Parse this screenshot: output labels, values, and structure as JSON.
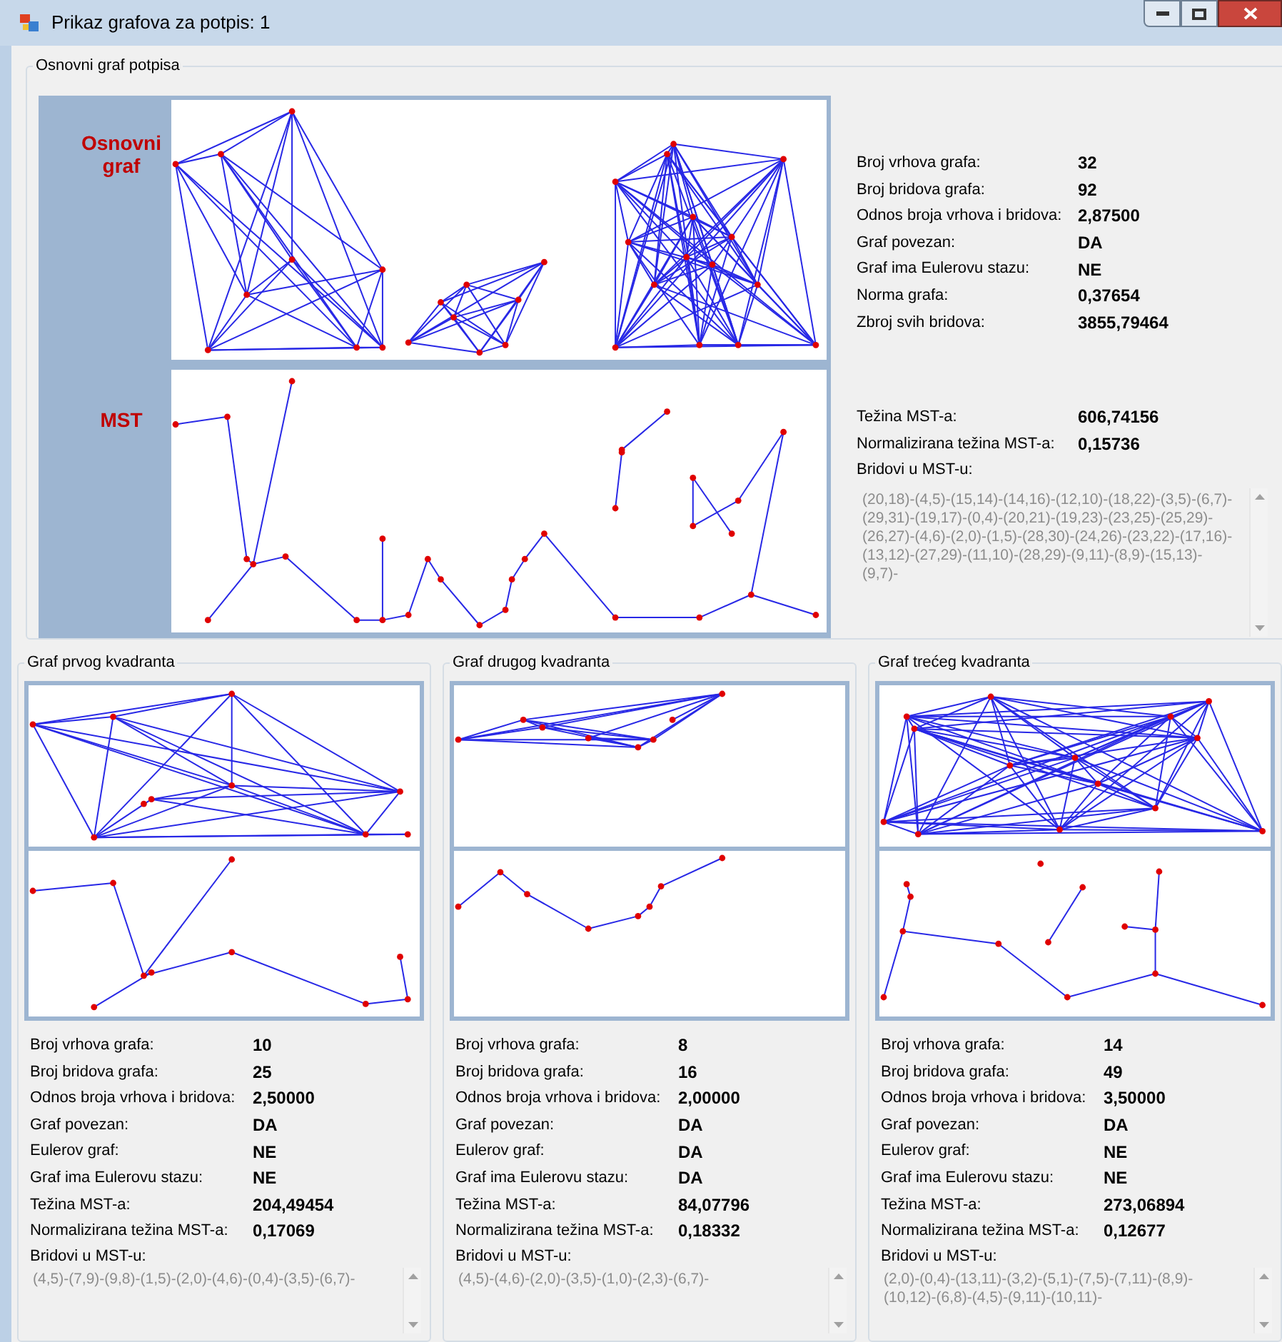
{
  "window": {
    "title": "Prikaz grafova za potpis: 1"
  },
  "main": {
    "title": "Osnovni graf potpisa",
    "graph_label": "Osnovni graf",
    "mst_label": "MST",
    "stats": [
      {
        "label": "Broj vrhova grafa:",
        "value": "32"
      },
      {
        "label": "Broj bridova grafa:",
        "value": "92"
      },
      {
        "label": "Odnos broja vrhova i bridova:",
        "value": "2,87500"
      },
      {
        "label": "Graf povezan:",
        "value": "DA"
      },
      {
        "label": "Graf ima Eulerovu stazu:",
        "value": "NE"
      },
      {
        "label": "Norma grafa:",
        "value": "0,37654"
      },
      {
        "label": "Zbroj svih bridova:",
        "value": "3855,79464"
      }
    ],
    "mst_stats": [
      {
        "label": "Težina MST-a:",
        "value": "606,74156"
      },
      {
        "label": "Normalizirana težina MST-a:",
        "value": "0,15736"
      }
    ],
    "edges_label": "Bridovi u MST-u:",
    "edges": "(20,18)-(4,5)-(15,14)-(14,16)-(12,10)-(18,22)-(3,5)-(6,7)-(29,31)-(19,17)-(0,4)-(20,21)-(19,23)-(23,25)-(25,29)-(26,27)-(4,6)-(2,0)-(1,5)-(28,30)-(24,26)-(23,22)-(17,16)-(13,12)-(27,29)-(11,10)-(28,29)-(9,11)-(8,9)-(15,13)-(9,7)-"
  },
  "quadrants": [
    {
      "title": "Graf prvog kvadranta",
      "stats": [
        {
          "label": "Broj vrhova grafa:",
          "value": "10"
        },
        {
          "label": "Broj bridova grafa:",
          "value": "25"
        },
        {
          "label": "Odnos broja vrhova i bridova:",
          "value": "2,50000"
        },
        {
          "label": "Graf povezan:",
          "value": "DA"
        },
        {
          "label": "Eulerov graf:",
          "value": "NE"
        },
        {
          "label": "Graf ima Eulerovu stazu:",
          "value": "NE"
        },
        {
          "label": "Težina MST-a:",
          "value": "204,49454"
        },
        {
          "label": "Normalizirana težina MST-a:",
          "value": "0,17069"
        }
      ],
      "edges_label": "Bridovi u MST-u:",
      "edges": "(4,5)-(7,9)-(9,8)-(1,5)-(2,0)-(4,6)-(0,4)-(3,5)-(6,7)-"
    },
    {
      "title": "Graf drugog kvadranta",
      "stats": [
        {
          "label": "Broj vrhova grafa:",
          "value": "8"
        },
        {
          "label": "Broj bridova grafa:",
          "value": "16"
        },
        {
          "label": "Odnos broja vrhova i bridova:",
          "value": "2,00000"
        },
        {
          "label": "Graf povezan:",
          "value": "DA"
        },
        {
          "label": "Eulerov graf:",
          "value": "DA"
        },
        {
          "label": "Graf ima Eulerovu stazu:",
          "value": "DA"
        },
        {
          "label": "Težina MST-a:",
          "value": "84,07796"
        },
        {
          "label": "Normalizirana težina MST-a:",
          "value": "0,18332"
        }
      ],
      "edges_label": "Bridovi u MST-u:",
      "edges": "(4,5)-(4,6)-(2,0)-(3,5)-(1,0)-(2,3)-(6,7)-"
    },
    {
      "title": "Graf trećeg kvadranta",
      "stats": [
        {
          "label": "Broj vrhova grafa:",
          "value": "14"
        },
        {
          "label": "Broj bridova grafa:",
          "value": "49"
        },
        {
          "label": "Odnos broja vrhova i bridova:",
          "value": "3,50000"
        },
        {
          "label": "Graf povezan:",
          "value": "DA"
        },
        {
          "label": "Eulerov graf:",
          "value": "NE"
        },
        {
          "label": "Graf ima Eulerovu stazu:",
          "value": "NE"
        },
        {
          "label": "Težina MST-a:",
          "value": "273,06894"
        },
        {
          "label": "Normalizirana težina MST-a:",
          "value": "0,12677"
        }
      ],
      "edges_label": "Bridovi u MST-u:",
      "edges": "(2,0)-(0,4)-(13,11)-(3,2)-(5,1)-(7,5)-(7,11)-(8,9)-(10,12)-(6,8)-(4,5)-(9,11)-(10,11)-"
    }
  ]
}
